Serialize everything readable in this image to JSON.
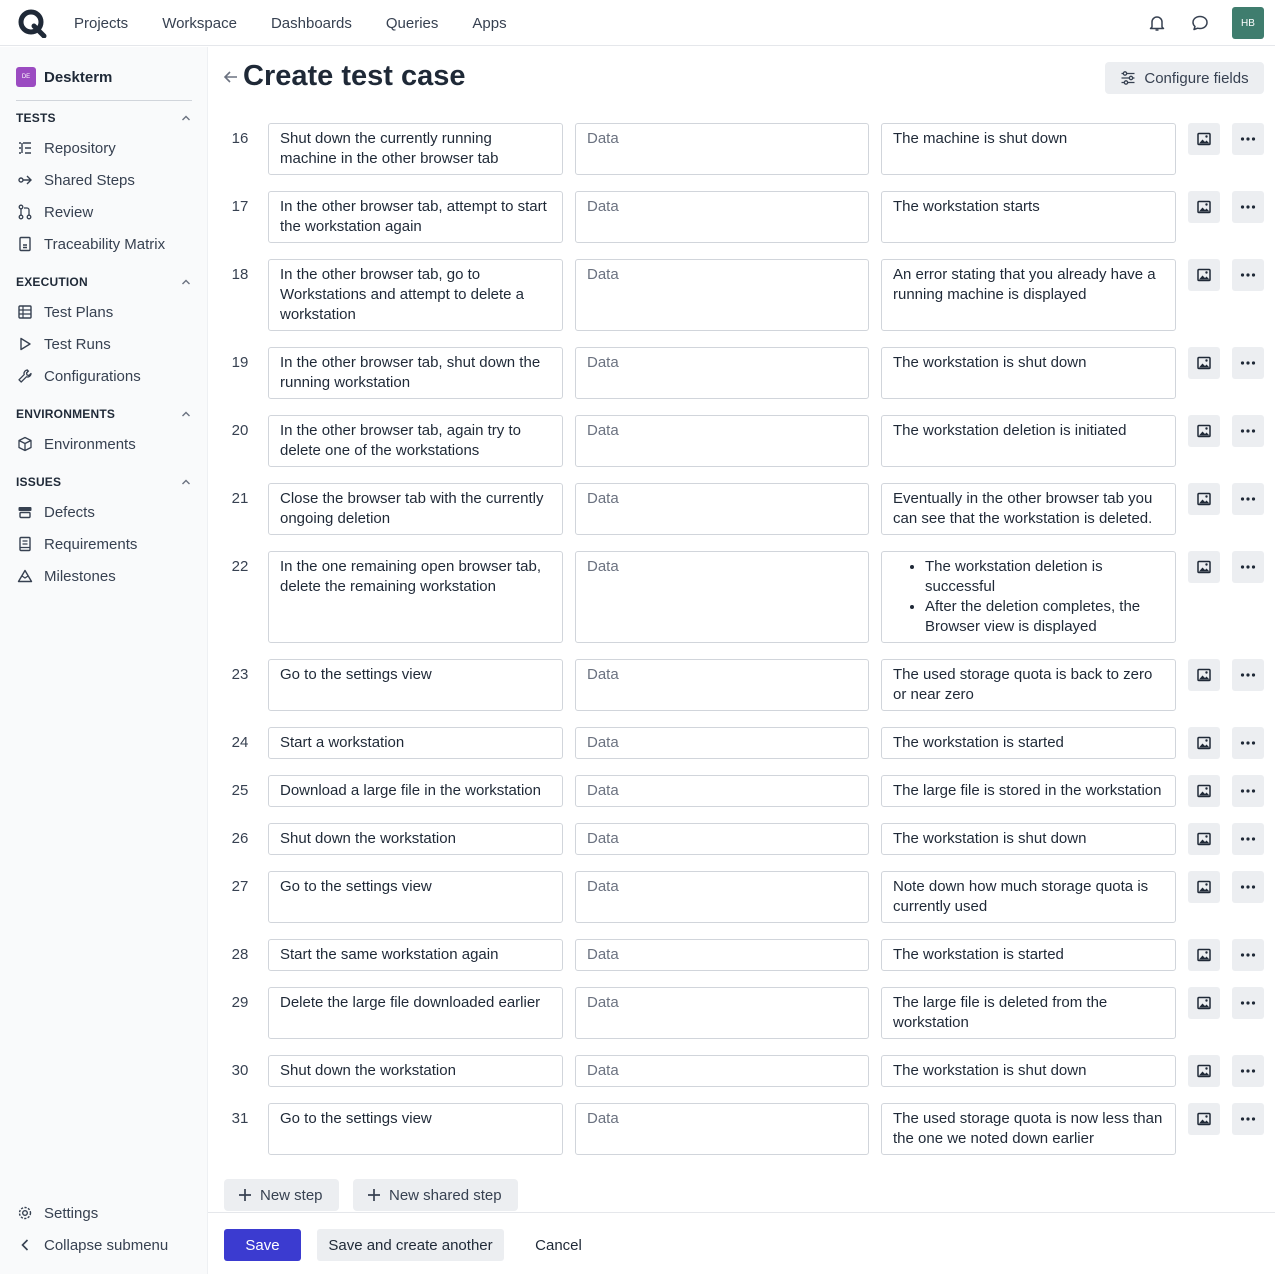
{
  "topbar": {
    "nav": [
      "Projects",
      "Workspace",
      "Dashboards",
      "Queries",
      "Apps"
    ],
    "avatar": "HB"
  },
  "sidebar": {
    "project_badge": "DE",
    "project_name": "Deskterm",
    "sections": [
      {
        "title": "TESTS",
        "items": [
          "Repository",
          "Shared Steps",
          "Review",
          "Traceability Matrix"
        ]
      },
      {
        "title": "EXECUTION",
        "items": [
          "Test Plans",
          "Test Runs",
          "Configurations"
        ]
      },
      {
        "title": "ENVIRONMENTS",
        "items": [
          "Environments"
        ]
      },
      {
        "title": "ISSUES",
        "items": [
          "Defects",
          "Requirements",
          "Milestones"
        ]
      }
    ],
    "bottom": [
      "Settings",
      "Collapse submenu"
    ]
  },
  "page": {
    "title": "Create test case",
    "configure_fields": "Configure fields"
  },
  "data_placeholder": "Data",
  "steps": [
    {
      "num": "16",
      "action": "Shut down the currently running machine in the other browser tab",
      "expected": "The machine is shut down"
    },
    {
      "num": "17",
      "action": "In the other browser tab, attempt to start the workstation again",
      "expected": "The workstation starts"
    },
    {
      "num": "18",
      "action": "In the other browser tab, go to Workstations and attempt to delete a workstation",
      "expected": "An error stating that you already have a running machine is displayed"
    },
    {
      "num": "19",
      "action": "In the other browser tab, shut down the running workstation",
      "expected": "The workstation is shut down"
    },
    {
      "num": "20",
      "action": "In the other browser tab, again try to delete one of the workstations",
      "expected": "The workstation deletion is initiated"
    },
    {
      "num": "21",
      "action": "Close the browser tab with the currently ongoing deletion",
      "expected": "Eventually in the other browser tab you can see that the workstation is deleted."
    },
    {
      "num": "22",
      "action": "In the one remaining open browser tab, delete the remaining workstation",
      "expected_list": [
        "The workstation deletion is successful",
        "After the deletion completes, the Browser view is displayed"
      ]
    },
    {
      "num": "23",
      "action": "Go to the settings view",
      "expected": "The used storage quota is back to zero or near zero"
    },
    {
      "num": "24",
      "action": "Start a workstation",
      "expected": "The workstation is started"
    },
    {
      "num": "25",
      "action": "Download a large file in the workstation",
      "expected": "The large file is stored in the workstation"
    },
    {
      "num": "26",
      "action": "Shut down the workstation",
      "expected": "The workstation is shut down"
    },
    {
      "num": "27",
      "action": "Go to the settings view",
      "expected": "Note down how much storage quota is currently used"
    },
    {
      "num": "28",
      "action": "Start the same workstation again",
      "expected": "The workstation is started"
    },
    {
      "num": "29",
      "action": "Delete the large file downloaded earlier",
      "expected": "The large file is deleted from the workstation"
    },
    {
      "num": "30",
      "action": "Shut down the workstation",
      "expected": "The workstation is shut down"
    },
    {
      "num": "31",
      "action": "Go to the settings view",
      "expected": "The used storage quota is now less than the one we noted down earlier"
    }
  ],
  "actions": {
    "new_step": "New step",
    "new_shared_step": "New shared step",
    "save": "Save",
    "save_and_create": "Save and create another",
    "cancel": "Cancel"
  },
  "colors": {
    "primary": "#3b3bd0",
    "avatar": "#3f7d6e",
    "project_badge": "#9b4bc1"
  }
}
